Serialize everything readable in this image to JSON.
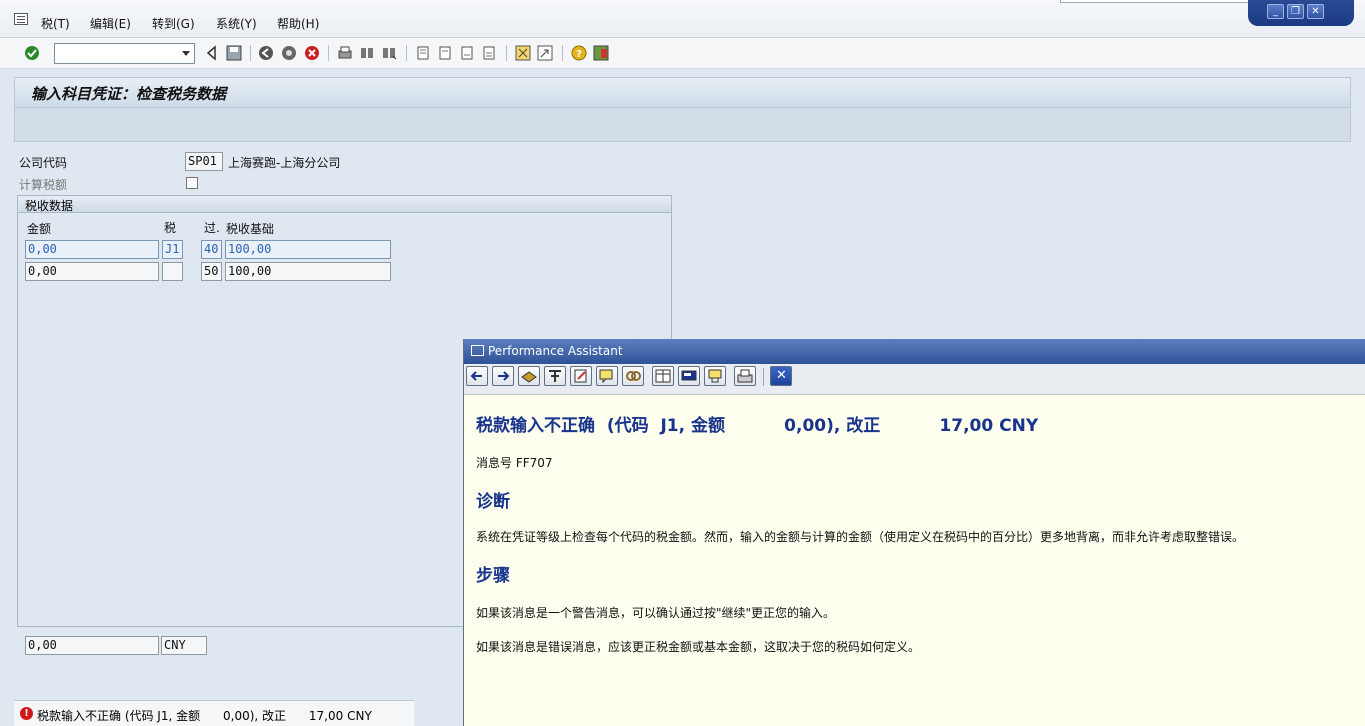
{
  "menubar": {
    "items": [
      "税(T)",
      "编辑(E)",
      "转到(G)",
      "系统(Y)",
      "帮助(H)"
    ]
  },
  "window_controls": {
    "minimize": "_",
    "restore": "❐",
    "close": "✕"
  },
  "toolbar": {
    "icons": [
      "enter-icon",
      "back-icon",
      "save-icon",
      "nav-back-icon",
      "exit-icon",
      "cancel-icon",
      "print-icon",
      "find-icon",
      "find-next-icon",
      "first-page-icon",
      "prev-page-icon",
      "next-page-icon",
      "last-page-icon",
      "create-session-icon",
      "shortcut-icon",
      "help-icon",
      "layout-icon"
    ]
  },
  "title": "输入科目凭证：检查税务数据",
  "form": {
    "company_code_label": "公司代码",
    "company_code": "SP01",
    "company_name": "上海赛跑-上海分公司",
    "calc_tax_label": "计算税额",
    "tax_box_title": "税收数据",
    "columns": {
      "amount": "金额",
      "tax": "税",
      "posting": "过.",
      "base": "税收基础"
    },
    "rows": [
      {
        "amount": "0,00",
        "tax": "J1",
        "posting": "40",
        "base": "100,00"
      },
      {
        "amount": "0,00",
        "tax": "",
        "posting": "50",
        "base": "100,00"
      }
    ],
    "total_amount": "0,00",
    "currency": "CNY"
  },
  "statusbar": {
    "message": "税款输入不正确 (代码 J1, 金额      0,00), 改正      17,00 CNY"
  },
  "performance_assistant": {
    "title": "Performance Assistant",
    "heading": "税款输入不正确  (代码  J1, 金额          0,00), 改正          17,00 CNY",
    "message_no": "消息号 FF707",
    "diagnosis_title": "诊断",
    "diagnosis_text": "系统在凭证等级上检查每个代码的税金额。然而，输入的金额与计算的金额（使用定义在税码中的百分比）更多地背离，而非允许考虑取整错误。",
    "steps_title": "步骤",
    "step1": "如果该消息是一个警告消息，可以确认通过按\"继续\"更正您的输入。",
    "step2": "如果该消息是错误消息，应该更正税金额或基本金额，这取决于您的税码如何定义。",
    "close_label": "✕"
  }
}
